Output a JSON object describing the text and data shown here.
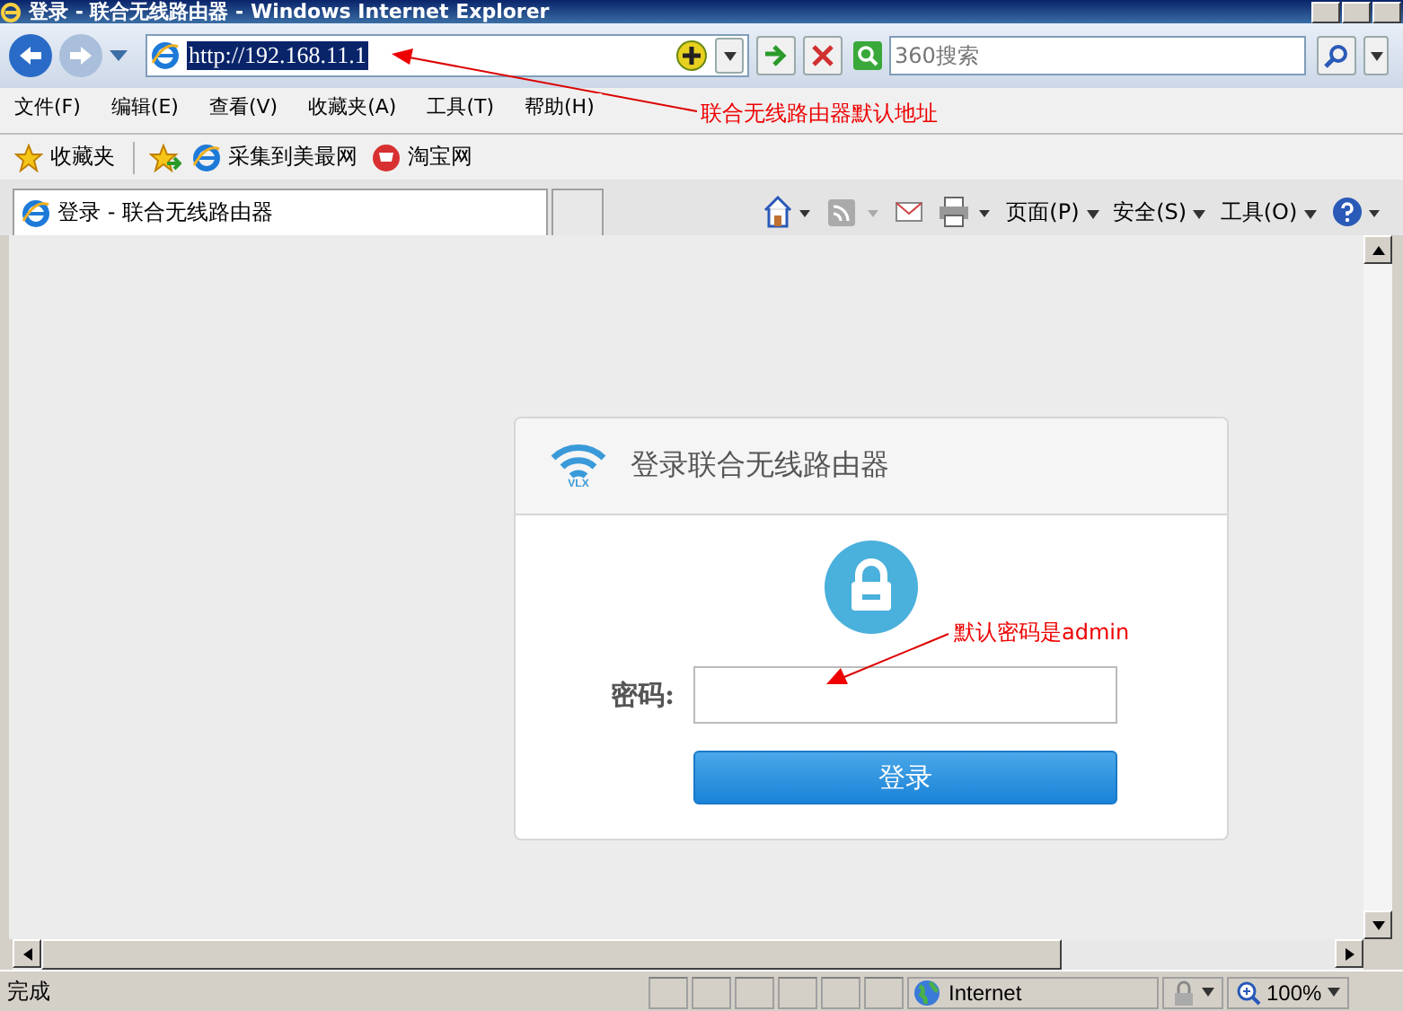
{
  "window": {
    "title": "登录 - 联合无线路由器 - Windows Internet Explorer"
  },
  "address_bar": {
    "url": "http://192.168.11.1",
    "selected": true
  },
  "search": {
    "placeholder": "360搜索"
  },
  "menu": [
    "文件(F)",
    "编辑(E)",
    "查看(V)",
    "收藏夹(A)",
    "工具(T)",
    "帮助(H)"
  ],
  "favorites": {
    "label": "收藏夹",
    "links": [
      {
        "label": "采集到美最网",
        "kind": "page"
      },
      {
        "label": "淘宝网",
        "kind": "shop"
      }
    ]
  },
  "tabs": [
    {
      "label": "登录 - 联合无线路由器",
      "selected": true
    }
  ],
  "command_bar": [
    "页面(P)",
    "安全(S)",
    "工具(O)"
  ],
  "login_card": {
    "title": "登录联合无线路由器",
    "brand": "VLX",
    "password_label": "密码:",
    "button": "登录"
  },
  "annotations": [
    {
      "text": "联合无线路由器默认地址"
    },
    {
      "text": "默认密码是admin"
    }
  ],
  "status_bar": {
    "text": "完成",
    "zone": "Internet",
    "zoom": "100%"
  }
}
